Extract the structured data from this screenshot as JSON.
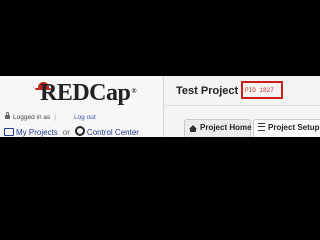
{
  "app": {
    "logo_text_a": "RED",
    "logo_text_b": "Cap",
    "logo_reg": "®"
  },
  "session": {
    "logged_in_label": "Logged in as",
    "separator": "|",
    "logout_label": "Log out"
  },
  "nav": {
    "my_projects_label": "My Projects",
    "or_label": "or",
    "control_center_label": "Control Center"
  },
  "project": {
    "title": "Test Project",
    "pid_label": "PID 1827"
  },
  "tabs": [
    {
      "label": "Project Home",
      "icon": "home-icon",
      "active": false
    },
    {
      "label": "Project Setup",
      "icon": "list-icon",
      "active": true
    }
  ],
  "colors": {
    "highlight_box": "#c8201c",
    "pid_text": "#c0392b",
    "link": "#1f3b8c",
    "logo_hat": "#c0271f"
  }
}
